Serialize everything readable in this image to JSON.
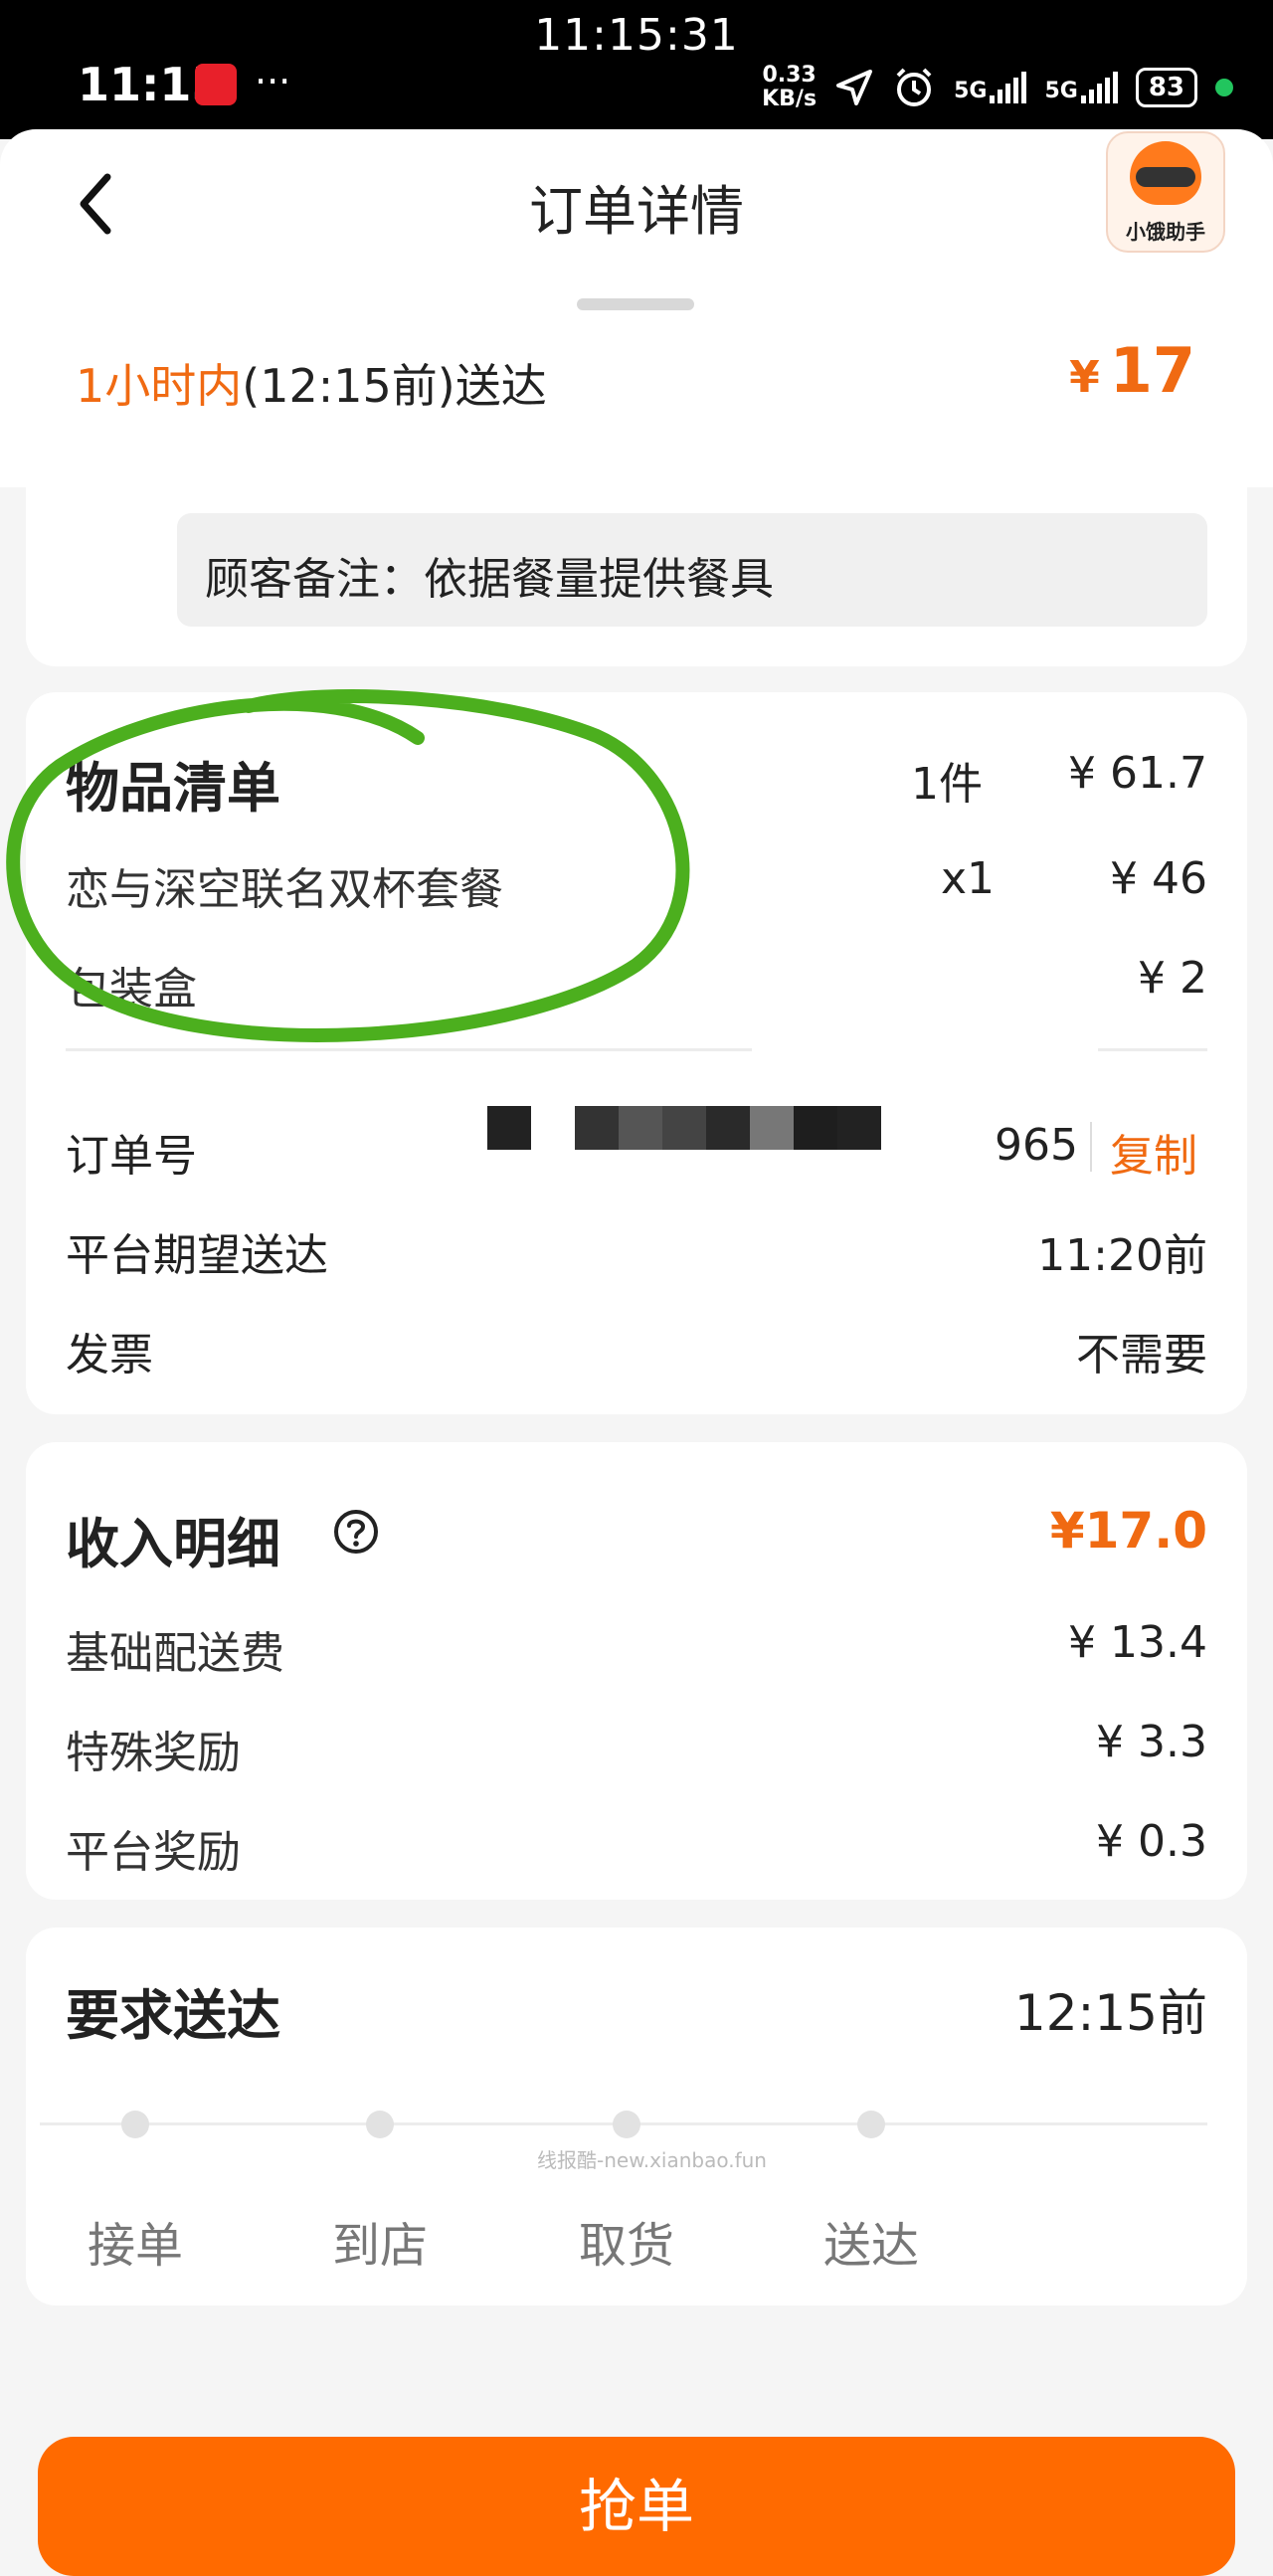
{
  "status_bar": {
    "center_time": "11:15:31",
    "time": "11:15",
    "speed_value": "0.33",
    "speed_unit": "KB/s",
    "signal1": "5G",
    "signal2": "5G",
    "battery": "83"
  },
  "header": {
    "title": "订单详情",
    "helper_label": "小饿助手"
  },
  "delivery": {
    "eta_highlight": "1小时内",
    "eta_rest": "(12:15前)送达",
    "price_currency": "¥",
    "price": "17"
  },
  "note": "顾客备注：依据餐量提供餐具",
  "items": {
    "title": "物品清单",
    "count": "1件",
    "total": "¥ 61.7",
    "list": [
      {
        "name": "恋与深空联名双杯套餐",
        "qty": "x1",
        "price": "¥ 46"
      },
      {
        "name": "包装盒",
        "qty": "",
        "price": "¥ 2"
      }
    ]
  },
  "order": {
    "order_no_label": "订单号",
    "order_no_tail": "965",
    "copy_label": "复制",
    "expected_label": "平台期望送达",
    "expected_value": "11:20前",
    "invoice_label": "发票",
    "invoice_value": "不需要"
  },
  "income": {
    "title": "收入明细",
    "total": "¥17.0",
    "rows": [
      {
        "label": "基础配送费",
        "value": "¥ 13.4"
      },
      {
        "label": "特殊奖励",
        "value": "¥ 3.3"
      },
      {
        "label": "平台奖励",
        "value": "¥ 0.3"
      }
    ]
  },
  "required": {
    "title": "要求送达",
    "value": "12:15前",
    "steps": [
      "接单",
      "到店",
      "取货",
      "送达"
    ],
    "watermark": "线报酷-new.xianbao.fun"
  },
  "action": {
    "grab_label": "抢单"
  },
  "colors": {
    "accent": "#f06a12",
    "button": "#ff6a00",
    "annotation": "#4caf1e"
  }
}
